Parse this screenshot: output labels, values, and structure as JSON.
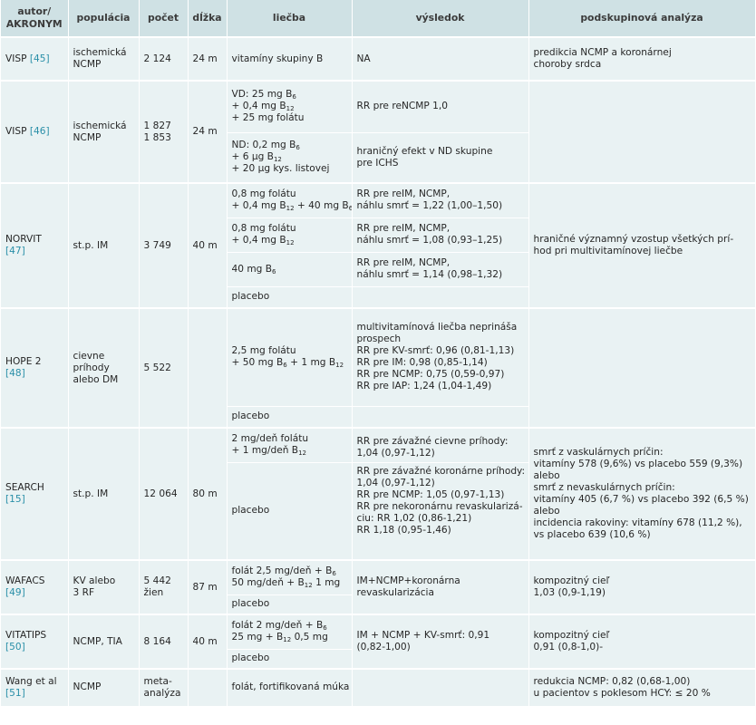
{
  "headers": [
    "autor/\nAKRONYM",
    "populácia",
    "počet",
    "dĺžka",
    "liečba",
    "výsledok",
    "podskupinová analýza"
  ],
  "rows": {
    "visp45": {
      "author": "VISP",
      "ref": "[45]",
      "population": [
        "ischemická",
        "NCMP"
      ],
      "count": [
        "2 124"
      ],
      "duration": "24 m",
      "treatment": [
        "vitamíny skupiny B"
      ],
      "result": [
        "NA"
      ],
      "subgroup": [
        "predikcia NCMP a koronárnej",
        "choroby srdca"
      ]
    },
    "visp46": {
      "author": "VISP",
      "ref": "[46]",
      "population": [
        "ischemická",
        "NCMP"
      ],
      "count": [
        "1 827",
        "1 853"
      ],
      "duration": "24 m",
      "arm1": {
        "treatment": [
          [
            "VD: 25 mg B",
            "6"
          ],
          [
            "+ 0,4 mg B",
            "12"
          ],
          [
            "+ 25 mg folátu",
            ""
          ]
        ],
        "result": [
          "RR pre reNCMP 1,0"
        ]
      },
      "arm2": {
        "treatment": [
          [
            "ND: 0,2 mg B",
            "6"
          ],
          [
            "+ 6 µg B",
            "12"
          ],
          [
            "+ 20 µg kys. listovej",
            ""
          ]
        ],
        "result": [
          "hraničný efekt v ND skupine",
          "pre ICHS"
        ]
      },
      "subgroup": []
    },
    "norvit": {
      "author": "NORVIT",
      "ref": "[47]",
      "population": [
        "st.p. IM"
      ],
      "count": [
        "3 749"
      ],
      "duration": "40 m",
      "arm1": {
        "treatment_l1": "0,8 mg folátu",
        "treatment_l2": [
          "+ 0,4 mg B",
          "12",
          " + 40 mg B",
          "6"
        ],
        "result": [
          "RR pre reIM, NCMP,",
          "náhlu smrť = 1,22 (1,00–1,50)"
        ]
      },
      "arm2": {
        "treatment": [
          [
            "0,8 mg folátu",
            ""
          ],
          [
            "+ 0,4 mg B",
            "12"
          ]
        ],
        "result": [
          "RR pre reIM, NCMP,",
          "náhlu smrť = 1,08 (0,93–1,25)"
        ]
      },
      "arm3": {
        "treatment": [
          [
            "40 mg B",
            "6"
          ]
        ],
        "result": [
          "RR pre reIM, NCMP,",
          "náhlu smrť = 1,14 (0,98–1,32)"
        ]
      },
      "arm4": {
        "treatment": "placebo",
        "result": []
      },
      "subgroup": [
        "hraničné významný vzostup všetkých prí-",
        "hod pri multivitamínovej liečbe"
      ]
    },
    "hope2": {
      "author": "HOPE 2",
      "ref": "[48]",
      "population": [
        "cievne",
        "príhody",
        "alebo DM"
      ],
      "count": [
        "5 522"
      ],
      "duration": "",
      "arm1": {
        "treatment_l1": "2,5 mg folátu",
        "treatment_l2": [
          "+ 50 mg B",
          "6",
          " + 1 mg B",
          "12"
        ],
        "result": [
          "multivitamínová liečba neprináša",
          "prospech",
          "RR pre KV-smrť: 0,96 (0,81-1,13)",
          "RR pre IM: 0,98 (0,85-1,14)",
          "RR pre NCMP: 0,75 (0,59-0,97)",
          "RR pre IAP: 1,24 (1,04-1,49)"
        ]
      },
      "arm2": {
        "treatment": "placebo"
      },
      "subgroup": []
    },
    "search": {
      "author": "SEARCH",
      "ref": "[15]",
      "population": [
        "st.p. IM"
      ],
      "count": [
        "12 064"
      ],
      "duration": "80 m",
      "arm1": {
        "treatment": [
          [
            "2 mg/deň folátu",
            ""
          ],
          [
            "+ 1 mg/deň B",
            "12"
          ]
        ],
        "result": [
          "RR pre závažné cievne príhody:",
          "1,04 (0,97-1,12)"
        ]
      },
      "arm2": {
        "treatment": "placebo",
        "result": [
          "RR pre závažné koronárne príhody:",
          "1,04 (0,97-1,12)",
          "RR pre NCMP: 1,05 (0,97-1,13)",
          "RR pre nekoronárnu revaskularizá-",
          "ciu: RR 1,02 (0,86-1,21)",
          "RR 1,18 (0,95-1,46)"
        ]
      },
      "subgroup": [
        "smrť z vaskulárnych príčin:",
        "vitamíny 578 (9,6%) vs placebo 559 (9,3%)",
        "alebo",
        "smrť z nevaskulárnych príčin:",
        "vitamíny 405 (6,7 %) vs placebo 392 (6,5 %)",
        "alebo",
        "incidencia rakoviny: vitamíny 678 (11,2 %),",
        "vs placebo 639 (10,6 %)"
      ]
    },
    "wafacs": {
      "author": "WAFACS",
      "ref": "[49]",
      "population": [
        "KV alebo",
        "3 RF"
      ],
      "count": [
        "5 442",
        "žien"
      ],
      "duration": "87 m",
      "arm1": {
        "treatment_l1": [
          "folát 2,5 mg/deň + B",
          "6"
        ],
        "treatment_l2": [
          "50 mg/deň + B",
          "12",
          " 1 mg"
        ],
        "result": [
          "IM+NCMP+koronárna",
          "revaskularizácia"
        ]
      },
      "arm2": {
        "treatment": "placebo"
      },
      "subgroup": [
        "kompozitný cieľ",
        "1,03 (0,9-1,19)"
      ]
    },
    "vitatips": {
      "author": "VITATIPS",
      "ref": "[50]",
      "population": [
        "NCMP, TIA"
      ],
      "count": [
        "8 164"
      ],
      "duration": "40 m",
      "arm1": {
        "treatment_l1": [
          "folát 2 mg/deň + B",
          "6"
        ],
        "treatment_l2": [
          "25 mg + B",
          "12",
          " 0,5 mg"
        ],
        "result": [
          "IM + NCMP + KV-smrť: 0,91",
          "(0,82-1,00)"
        ]
      },
      "arm2": {
        "treatment": "placebo"
      },
      "subgroup": [
        "kompozitný cieľ",
        "0,91 (0,8-1,0)-"
      ]
    },
    "wang": {
      "author": "Wang et al",
      "ref": "[51]",
      "population": [
        "NCMP"
      ],
      "count": [
        "meta-",
        "analýza"
      ],
      "duration": "",
      "treatment": [
        "folát, fortifikovaná múka"
      ],
      "result": [],
      "subgroup": [
        "redukcia NCMP: 0,82 (0,68-1,00)",
        "u pacientov s poklesom HCY: ≤ 20 %"
      ]
    }
  }
}
